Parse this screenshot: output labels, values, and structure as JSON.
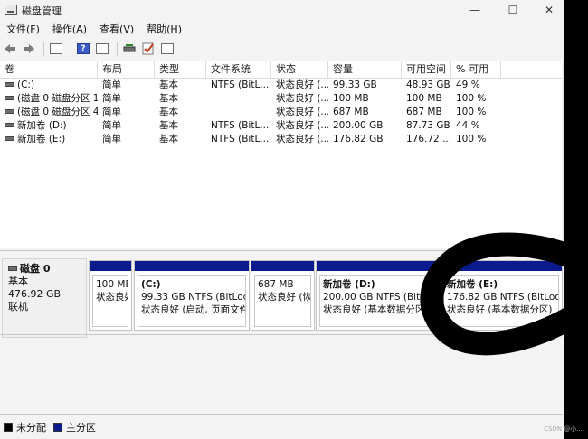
{
  "window": {
    "title": "磁盘管理",
    "minimize": "—",
    "maximize": "☐",
    "close": "✕"
  },
  "menu": [
    "文件(F)",
    "操作(A)",
    "查看(V)",
    "帮助(H)"
  ],
  "toolbar": {
    "icons": [
      "back-arrow-icon",
      "forward-arrow-icon",
      "console-tree-icon",
      "help-icon",
      "properties-icon",
      "disk-icon",
      "check-icon",
      "list-view-icon"
    ],
    "help_glyph": "?"
  },
  "volume_table": {
    "columns": [
      "卷",
      "布局",
      "类型",
      "文件系统",
      "状态",
      "容量",
      "可用空间",
      "% 可用"
    ],
    "rows": [
      {
        "volume": "(C:)",
        "layout": "简单",
        "type": "基本",
        "fs": "NTFS (BitL...",
        "status": "状态良好 (...",
        "capacity": "99.33 GB",
        "free": "48.93 GB",
        "pct": "49 %"
      },
      {
        "volume": "(磁盘 0 磁盘分区 1)",
        "layout": "简单",
        "type": "基本",
        "fs": "",
        "status": "状态良好 (...",
        "capacity": "100 MB",
        "free": "100 MB",
        "pct": "100 %"
      },
      {
        "volume": "(磁盘 0 磁盘分区 4)",
        "layout": "简单",
        "type": "基本",
        "fs": "",
        "status": "状态良好 (...",
        "capacity": "687 MB",
        "free": "687 MB",
        "pct": "100 %"
      },
      {
        "volume": "新加卷 (D:)",
        "layout": "简单",
        "type": "基本",
        "fs": "NTFS (BitL...",
        "status": "状态良好 (...",
        "capacity": "200.00 GB",
        "free": "87.73 GB",
        "pct": "44 %"
      },
      {
        "volume": "新加卷 (E:)",
        "layout": "简单",
        "type": "基本",
        "fs": "NTFS (BitL...",
        "status": "状态良好 (...",
        "capacity": "176.82 GB",
        "free": "176.72 ...",
        "pct": "100 %"
      }
    ]
  },
  "disk0": {
    "name": "磁盘 0",
    "type": "基本",
    "size": "476.92 GB",
    "state": "联机",
    "partitions": [
      {
        "label": "",
        "line1": "100 MB",
        "line2": "状态良好"
      },
      {
        "label": "(C:)",
        "line1": "99.33 GB NTFS (BitLocker",
        "line2": "状态良好 (启动, 页面文件,"
      },
      {
        "label": "",
        "line1": "687 MB",
        "line2": "状态良好 (恢复"
      },
      {
        "label": "新加卷 (D:)",
        "line1": "200.00 GB NTFS (BitLocke",
        "line2": "状态良好 (基本数据分区)"
      },
      {
        "label": "新加卷 (E:)",
        "line1": "176.82 GB NTFS (BitLocker",
        "line2": "状态良好 (基本数据分区)"
      }
    ]
  },
  "legend": [
    {
      "label": "未分配",
      "color": "#000000"
    },
    {
      "label": "主分区",
      "color": "#0b1a8c"
    }
  ],
  "watermark": "CSDN @小..."
}
